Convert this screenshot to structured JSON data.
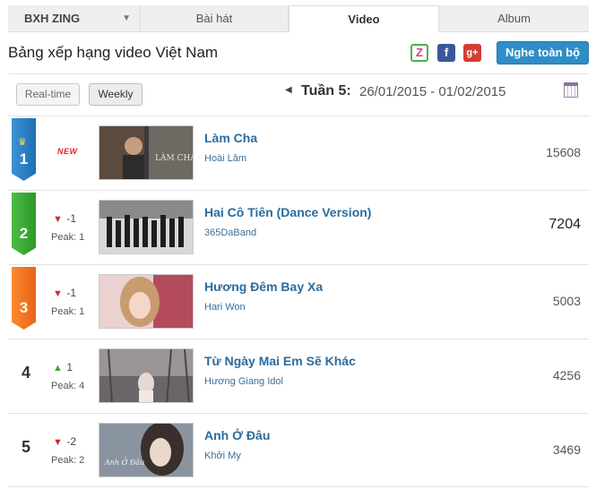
{
  "tabs": {
    "chart": "BXH ZING",
    "songs": "Bài hát",
    "video": "Video",
    "album": "Album"
  },
  "header": {
    "title": "Bảng xếp hạng video Việt Nam",
    "play_all": "Nghe toàn bộ",
    "social_zing": "Z",
    "social_fb": "f",
    "social_gp": "g+"
  },
  "filters": {
    "realtime": "Real-time",
    "weekly": "Weekly",
    "week_label": "Tuần 5:",
    "week_range": "26/01/2015 - 01/02/2015"
  },
  "rows": [
    {
      "rank": "1",
      "badge": "blue",
      "status": "NEW",
      "change": "",
      "direction": "",
      "peak": "",
      "title": "Làm Cha",
      "artist": "Hoài Lâm",
      "views": "15608",
      "thumb_text": "LÀM CHA"
    },
    {
      "rank": "2",
      "badge": "green",
      "status": "",
      "change": "-1",
      "direction": "down",
      "peak": "Peak: 1",
      "title": "Hai Cô Tiên (Dance Version)",
      "artist": "365DaBand",
      "views": "7204",
      "thumb_text": ""
    },
    {
      "rank": "3",
      "badge": "orange",
      "status": "",
      "change": "-1",
      "direction": "down",
      "peak": "Peak: 1",
      "title": "Hương Đêm Bay Xa",
      "artist": "Hari Won",
      "views": "5003",
      "thumb_text": ""
    },
    {
      "rank": "4",
      "badge": "",
      "status": "",
      "change": "1",
      "direction": "up",
      "peak": "Peak: 4",
      "title": "Từ Ngày Mai Em Sẽ Khác",
      "artist": "Hương Giang Idol",
      "views": "4256",
      "thumb_text": ""
    },
    {
      "rank": "5",
      "badge": "",
      "status": "",
      "change": "-2",
      "direction": "down",
      "peak": "Peak: 2",
      "title": "Anh Ở Đâu",
      "artist": "Khởi My",
      "views": "3469",
      "thumb_text": "Anh Ở Đâu"
    }
  ]
}
